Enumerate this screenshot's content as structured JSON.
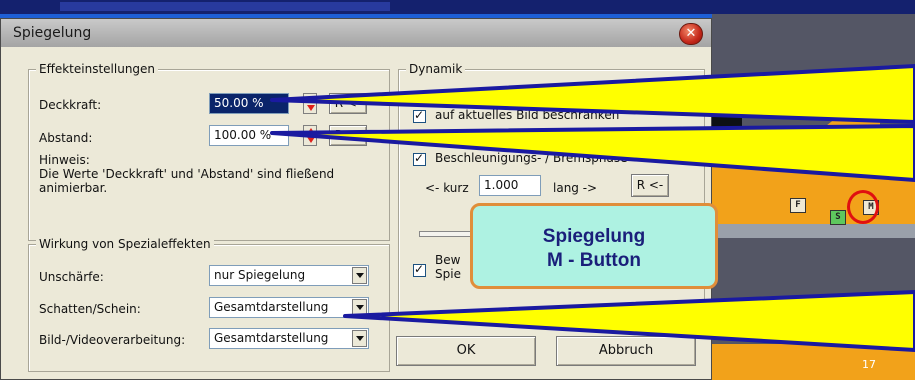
{
  "dialog": {
    "title": "Spiegelung",
    "close_label": "✕"
  },
  "effekteinstellungen": {
    "legend": "Effekteinstellungen",
    "deckkraft_label": "Deckkraft:",
    "deckkraft_value": "50.00 %",
    "abstand_label": "Abstand:",
    "abstand_value": "100.00 %",
    "reset_label": "R <-",
    "hinweis_title": "Hinweis:",
    "hinweis_text_1": "Die Werte 'Deckkraft' und 'Abstand' sind fließend",
    "hinweis_text_2": "animierbar."
  },
  "spezialeffekte": {
    "legend": "Wirkung von Spezialeffekten",
    "unschaerfe_label": "Unschärfe:",
    "unschaerfe_value": "nur Spiegelung",
    "schatten_label": "Schatten/Schein:",
    "schatten_value": "Gesamtdarstellung",
    "bild_label": "Bild-/Videoverarbeitung:",
    "bild_value": "Gesamtdarstellung"
  },
  "dynamik": {
    "legend": "Dynamik",
    "checkbox_bild": "auf aktuelles Bild beschränken",
    "checkbox_beschl": "Beschleunigungs- / Bremsphase",
    "kurz_label": "<- kurz",
    "kurz_value": "1.000",
    "lang_label": "lang ->",
    "reset_label": "R <-",
    "checkbox_bew_1": "Bew",
    "checkbox_bew_2": "Spie"
  },
  "buttons": {
    "ok": "OK",
    "abbruch": "Abbruch"
  },
  "callout": {
    "line1": "Spiegelung",
    "line2": "M - Button"
  },
  "timeline": {
    "markers": [
      "F",
      "S",
      "M"
    ],
    "bottom_label": "17"
  },
  "colors": {
    "pointer_fill": "#ffff00",
    "pointer_stroke": "#1a1aa0",
    "callout_bg": "#aef2e2",
    "callout_border": "#e08e3a",
    "highlight_circle": "#e01010"
  }
}
